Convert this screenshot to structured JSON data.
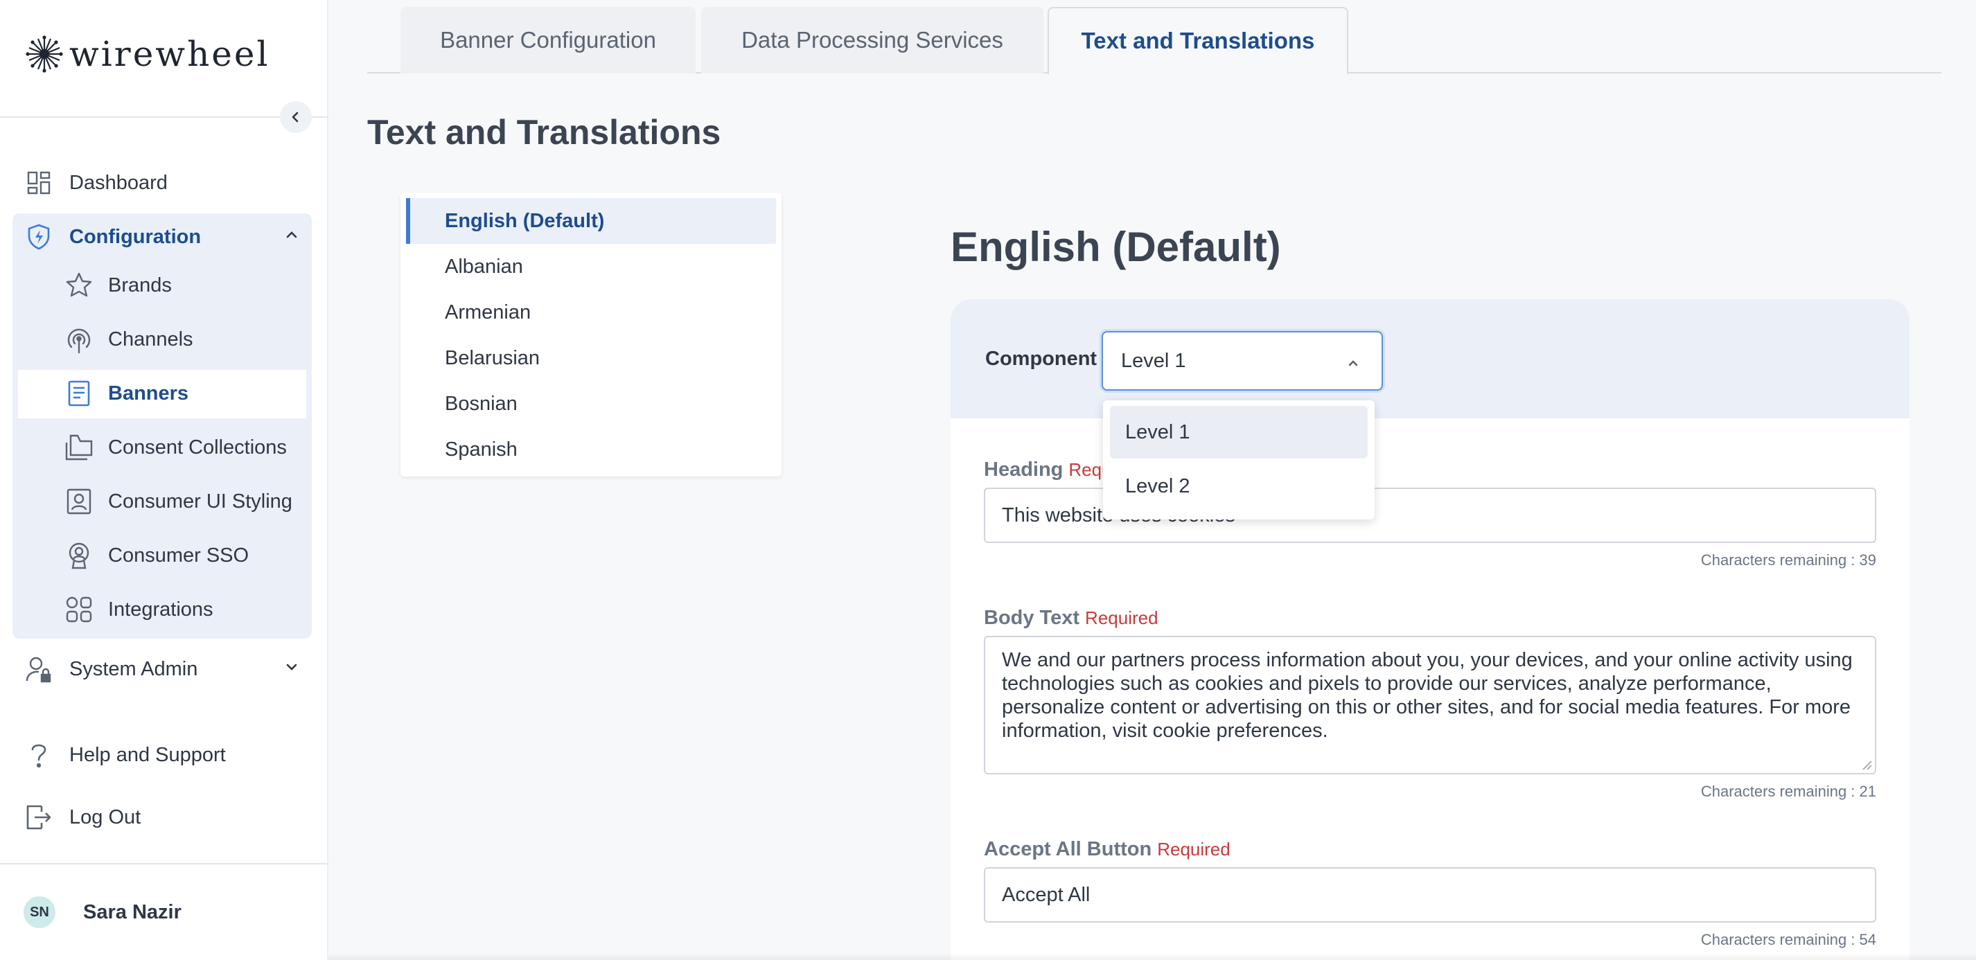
{
  "brand": {
    "logo_text": "wirewheel"
  },
  "sidebar": {
    "dashboard": "Dashboard",
    "configuration": "Configuration",
    "config_items": [
      {
        "label": "Brands",
        "icon": "star-icon"
      },
      {
        "label": "Channels",
        "icon": "broadcast-icon"
      },
      {
        "label": "Banners",
        "icon": "banner-doc-icon",
        "active": true
      },
      {
        "label": "Consent Collections",
        "icon": "folders-icon"
      },
      {
        "label": "Consumer UI Styling",
        "icon": "portrait-icon"
      },
      {
        "label": "Consumer SSO",
        "icon": "user-badge-icon"
      },
      {
        "label": "Integrations",
        "icon": "grid-icon"
      }
    ],
    "system_admin": "System Admin",
    "help": "Help and Support",
    "logout": "Log Out"
  },
  "user": {
    "initials": "SN",
    "name": "Sara Nazir"
  },
  "tabs": [
    {
      "label": "Banner Configuration",
      "active": false
    },
    {
      "label": "Data Processing Services",
      "active": false
    },
    {
      "label": "Text and Translations",
      "active": true
    }
  ],
  "page_title": "Text and Translations",
  "languages": [
    {
      "label": "English (Default)",
      "active": true
    },
    {
      "label": "Albanian"
    },
    {
      "label": "Armenian"
    },
    {
      "label": "Belarusian"
    },
    {
      "label": "Bosnian"
    },
    {
      "label": "Spanish"
    }
  ],
  "form": {
    "heading": "English (Default)",
    "component_label": "Component",
    "component_value": "Level 1",
    "component_options": [
      "Level 1",
      "Level 2"
    ],
    "required_text": "Required",
    "heading_field": {
      "label": "Heading",
      "value": "This website uses cookies",
      "counter": "Characters remaining : 39"
    },
    "body_field": {
      "label": "Body Text",
      "value": "We and our partners process information about you, your devices, and your online activity using technologies such as cookies and pixels to provide our services, analyze performance, personalize content or advertising on this or other sites, and for social media features. For more information, visit cookie preferences.",
      "counter": "Characters remaining : 21"
    },
    "accept_field": {
      "label": "Accept All Button",
      "value": "Accept All",
      "counter": "Characters remaining : 54"
    }
  },
  "colors": {
    "accent": "#1e4d8c",
    "active_bar": "#3e7bd6",
    "required": "#c93a3a",
    "highlight_bg": "#eaeff8"
  }
}
